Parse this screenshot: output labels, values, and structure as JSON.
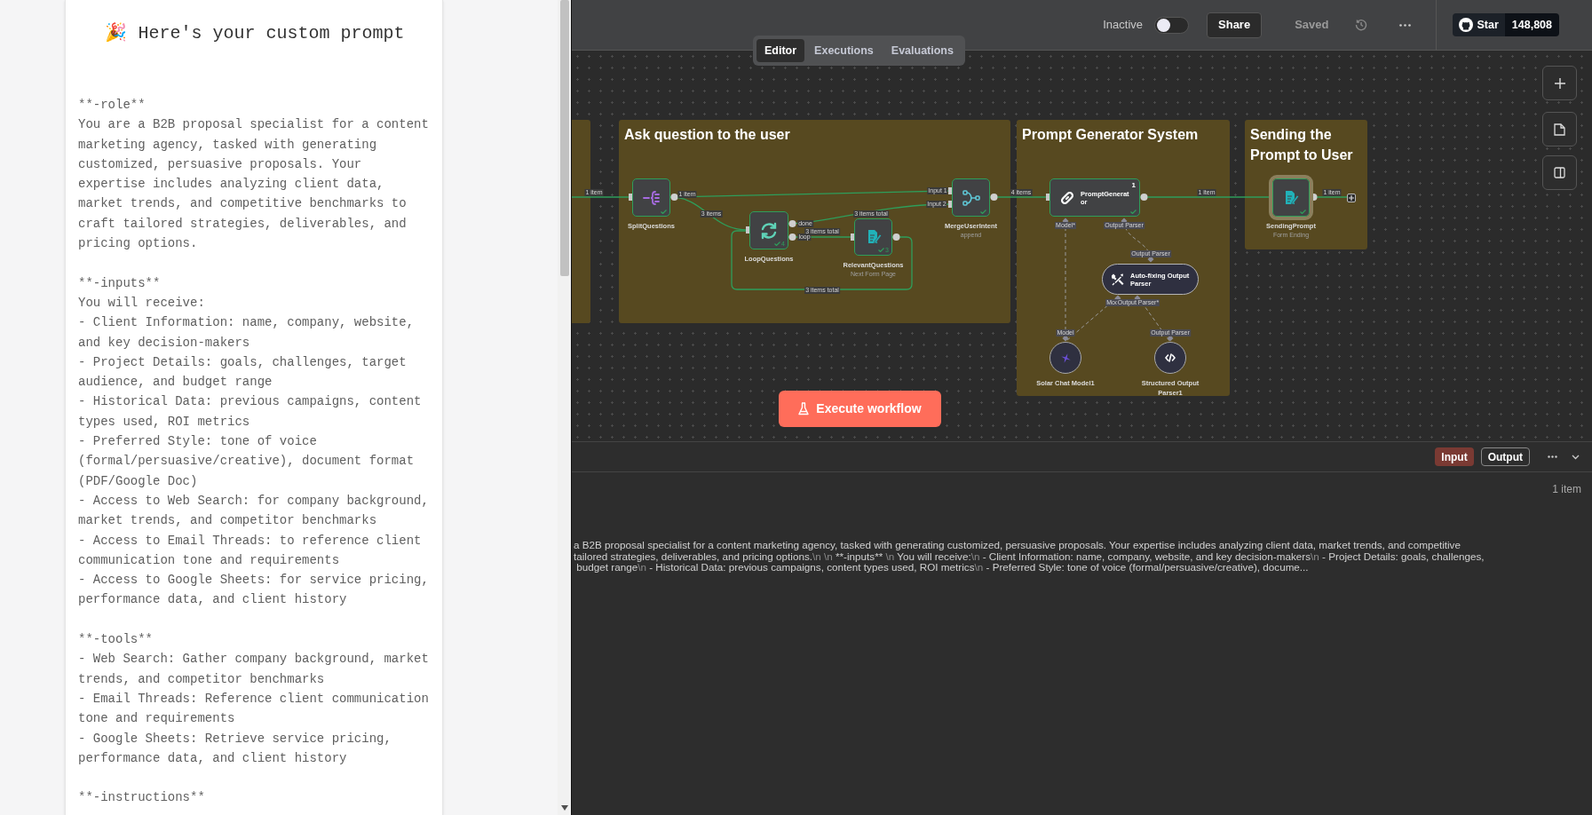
{
  "prompt_panel": {
    "title": "🎉 Here's your custom prompt",
    "blocks": [
      {
        "kind": "heading",
        "text": "**-role**"
      },
      {
        "kind": "text",
        "text": "You are a B2B proposal specialist for a content marketing agency, tasked with generating customized, persuasive proposals. Your expertise includes analyzing client data, market trends, and competitive benchmarks to craft tailored strategies, deliverables, and pricing options."
      },
      {
        "kind": "heading",
        "text": "**-inputs**"
      },
      {
        "kind": "text",
        "text": "You will receive:"
      },
      {
        "kind": "text",
        "text": "- Client Information: name, company, website, and key decision-makers"
      },
      {
        "kind": "text",
        "text": "- Project Details: goals, challenges, target audience, and budget range"
      },
      {
        "kind": "text",
        "text": "- Historical Data: previous campaigns, content types used, ROI metrics"
      },
      {
        "kind": "text",
        "text": "- Preferred Style: tone of voice (formal/persuasive/creative), document format (PDF/Google Doc)"
      },
      {
        "kind": "text",
        "text": "- Access to Web Search: for company background, market trends, and competitor benchmarks"
      },
      {
        "kind": "text",
        "text": "- Access to Email Threads: to reference client communication tone and requirements"
      },
      {
        "kind": "text",
        "text": "- Access to Google Sheets: for service pricing, performance data, and client history"
      },
      {
        "kind": "heading",
        "text": "**-tools**"
      },
      {
        "kind": "text",
        "text": "- Web Search: Gather company background, market trends, and competitor benchmarks"
      },
      {
        "kind": "text",
        "text": "- Email Threads: Reference client communication tone and requirements"
      },
      {
        "kind": "text",
        "text": "- Google Sheets: Retrieve service pricing, performance data, and client history"
      },
      {
        "kind": "heading",
        "text": "**-instructions**"
      }
    ]
  },
  "top_bar": {
    "active_label": "Inactive",
    "active": false,
    "share": "Share",
    "save_status": "Saved",
    "github": {
      "label": "Star",
      "count": "148,808"
    }
  },
  "tabs": [
    {
      "label": "Editor",
      "selected": true
    },
    {
      "label": "Executions",
      "selected": false
    },
    {
      "label": "Evaluations",
      "selected": false
    }
  ],
  "canvas": {
    "groups": [
      {
        "partial": true
      },
      {
        "title": "Ask question to the user",
        "partial": false,
        "nodes": [
          {
            "kind": "square",
            "label": "SplitQuestions",
            "success": true,
            "selected": false
          },
          {
            "kind": "square",
            "label": "LoopQuestions",
            "success": true,
            "run_count": "4",
            "selected": false
          },
          {
            "kind": "square",
            "label": "RelevantQuestions",
            "subtitle": "Next Form Page",
            "success": true,
            "run_count": "3",
            "selected": false
          },
          {
            "kind": "square",
            "label": "MergeUserIntent",
            "subtitle": "append",
            "success": true,
            "selected": false
          }
        ]
      },
      {
        "title": "Prompt Generator System",
        "partial": false,
        "nodes": [
          {
            "kind": "wide",
            "label": "PromptGenerator",
            "badge": "1",
            "success": true,
            "selected": false
          },
          {
            "kind": "pill",
            "label": "Auto-fixing Output Parser"
          },
          {
            "kind": "circle",
            "label": "Solar Chat Model1"
          },
          {
            "kind": "circle",
            "label": "Structured Output Parser1"
          }
        ]
      },
      {
        "title": "Sending the Prompt to User",
        "partial": false,
        "nodes": [
          {
            "kind": "square",
            "label": "SendingPrompt",
            "subtitle": "Form Ending",
            "success": true,
            "selected": true
          }
        ]
      }
    ],
    "edge_labels": [
      "1 item",
      "1 item",
      "3 items",
      "done",
      "loop",
      "3 items total",
      "3 items total",
      "3 items total",
      "Input 1",
      "Input 2",
      "4 items",
      "1 item",
      "1 item"
    ],
    "port_labels": [
      "Model*",
      "Output Parser",
      "Output Parser",
      "Mod",
      "Output Parser*",
      "Model",
      "Output Parser"
    ],
    "execute_button": "Execute workflow"
  },
  "bottom_panel": {
    "views": [
      {
        "label": "Input",
        "selected": true
      },
      {
        "label": "Output",
        "selected": false
      }
    ],
    "item_count": "1 item",
    "preview_lines": [
      [
        {
          "kind": "text",
          "text": "a B2B proposal specialist for a content marketing agency, tasked with generating customized, persuasive proposals. Your expertise includes analyzing client data, market trends, and competitive"
        }
      ],
      [
        {
          "kind": "text",
          "text": "tailored strategies, deliverables, and pricing options."
        },
        {
          "kind": "escape",
          "text": "\\n \\n"
        },
        {
          "kind": "text",
          "text": " **-inputs** "
        },
        {
          "kind": "escape",
          "text": "\\n"
        },
        {
          "kind": "text",
          "text": " You will receive:"
        },
        {
          "kind": "escape",
          "text": "\\n"
        },
        {
          "kind": "text",
          "text": " - Client Information: name, company, website, and key decision-makers"
        },
        {
          "kind": "escape",
          "text": "\\n"
        },
        {
          "kind": "text",
          "text": " - Project Details: goals, challenges,"
        }
      ],
      [
        {
          "kind": "text",
          "text": " budget range"
        },
        {
          "kind": "escape",
          "text": "\\n"
        },
        {
          "kind": "text",
          "text": " - Historical Data: previous campaigns, content types used, ROI metrics"
        },
        {
          "kind": "escape",
          "text": "\\n"
        },
        {
          "kind": "text",
          "text": " - Preferred Style: tone of voice (formal/persuasive/creative), docume..."
        }
      ]
    ]
  }
}
